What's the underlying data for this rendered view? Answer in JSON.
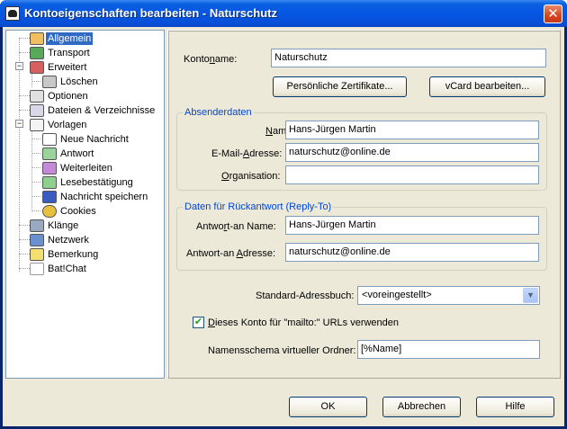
{
  "window": {
    "title": "Kontoeigenschaften bearbeiten - Naturschutz",
    "close_glyph": "✕"
  },
  "tree": {
    "items": [
      {
        "label": "Allgemein",
        "icon": "general-icon",
        "selected": true
      },
      {
        "label": "Transport",
        "icon": "transport-icon"
      },
      {
        "label": "Erweitert",
        "icon": "advanced-icon"
      },
      {
        "label": "Löschen",
        "icon": "delete-icon"
      },
      {
        "label": "Optionen",
        "icon": "options-icon"
      },
      {
        "label": "Dateien & Verzeichnisse",
        "icon": "folders-icon"
      },
      {
        "label": "Vorlagen",
        "icon": "templates-icon"
      },
      {
        "label": "Neue Nachricht",
        "icon": "new-message-icon"
      },
      {
        "label": "Antwort",
        "icon": "reply-icon"
      },
      {
        "label": "Weiterleiten",
        "icon": "forward-icon"
      },
      {
        "label": "Lesebestätigung",
        "icon": "read-receipt-icon"
      },
      {
        "label": "Nachricht speichern",
        "icon": "save-message-icon"
      },
      {
        "label": "Cookies",
        "icon": "cookies-icon"
      },
      {
        "label": "Klänge",
        "icon": "sounds-icon"
      },
      {
        "label": "Netzwerk",
        "icon": "network-icon"
      },
      {
        "label": "Bemerkung",
        "icon": "note-icon"
      },
      {
        "label": "Bat!Chat",
        "icon": "chat-icon"
      }
    ]
  },
  "form": {
    "account_name_label_a": "Konto",
    "account_name_label_b": "n",
    "account_name_label_c": "ame:",
    "account_name_value": "Naturschutz",
    "certs_button": "Persönliche Zertifikate...",
    "vcard_button": "vCard bearbeiten...",
    "sender_group": "Absenderdaten",
    "name_label_a": "N",
    "name_label_b": "ame:",
    "name_value": "Hans-Jürgen Martin",
    "email_label_a": "E-Mail-",
    "email_label_b": "A",
    "email_label_c": "dresse:",
    "email_value": "naturschutz@online.de",
    "org_label_a": "O",
    "org_label_b": "rganisation:",
    "org_value": "",
    "reply_group": "Daten für Rückantwort (Reply-To)",
    "reply_name_label_a": "Antwo",
    "reply_name_label_b": "r",
    "reply_name_label_c": "t-an Name:",
    "reply_name_value": "Hans-Jürgen Martin",
    "reply_addr_label_a": "Antwort-an ",
    "reply_addr_label_b": "A",
    "reply_addr_label_c": "dresse:",
    "reply_addr_value": "naturschutz@online.de",
    "addressbook_label": "Standard-Adressbuch:",
    "addressbook_value": "<voreingestellt>",
    "mailto_label_a": "D",
    "mailto_label_b": "ieses Konto für \"mailto:\" URLs verwenden",
    "mailto_checked": true,
    "check_glyph": "✔",
    "naming_label": "Namensschema virtueller Ordner:",
    "naming_value": "[%Name]"
  },
  "buttons": {
    "ok": "OK",
    "cancel": "Abbrechen",
    "help": "Hilfe"
  },
  "colors": {
    "selection": "#316ac5",
    "group_title": "#0046d5",
    "titlebar": "#0556e3"
  }
}
